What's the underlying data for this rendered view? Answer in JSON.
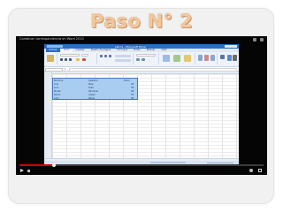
{
  "slide": {
    "title": "Paso N° 2"
  },
  "player": {
    "window_title": "Combinar correspondencia en Word 2010",
    "progress": 0.14,
    "time": "",
    "excel": {
      "title": "Libro1 - Microsoft Excel",
      "tabs": [
        "Archivo",
        "Inicio",
        "Insertar",
        "Diseño de página",
        "Fórmulas",
        "Datos",
        "Revisar",
        "Vista"
      ],
      "cells": [
        [
          "Nombre",
          "Apellido",
          "Edad"
        ],
        [
          "Ana",
          "Ruiz",
          "25"
        ],
        [
          "Luis",
          "Díaz",
          "30"
        ],
        [
          "Marta",
          "Sánchez",
          "28"
        ],
        [
          "Pedro",
          "López",
          "35"
        ],
        [
          "Juan",
          "Pérez",
          "40"
        ]
      ]
    }
  }
}
